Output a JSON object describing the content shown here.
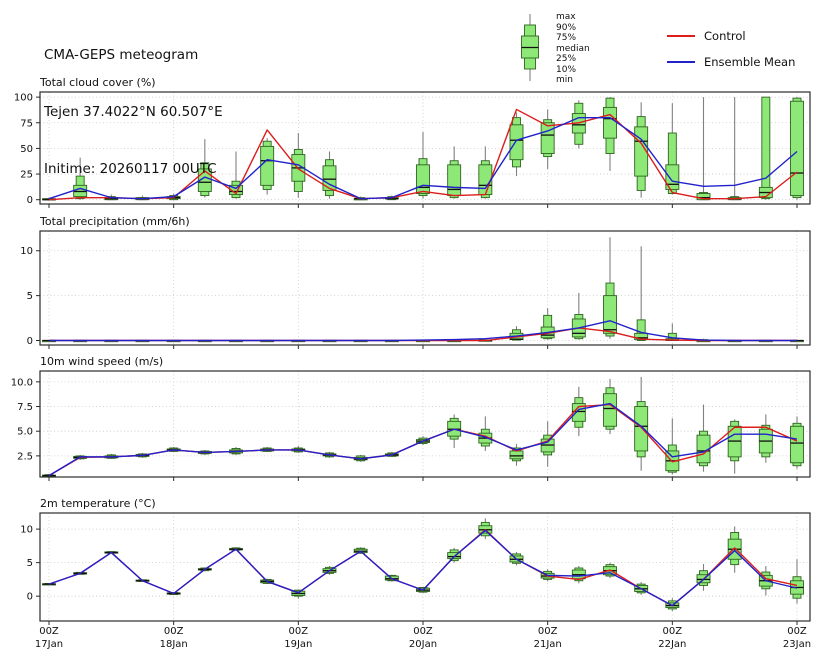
{
  "header": {
    "title": "CMA-GEPS meteogram",
    "location": "Tejen 37.4022°N 60.507°E",
    "inittime": "Initime: 20260117 00UTC"
  },
  "legend": {
    "box_labels": [
      "max",
      "90%",
      "75%",
      "median",
      "25%",
      "10%",
      "min"
    ],
    "series": [
      {
        "label": "Control",
        "color": "#dd1c1c"
      },
      {
        "label": "Ensemble Mean",
        "color": "#2222cc"
      }
    ]
  },
  "colors": {
    "box_fill": "#8ee878",
    "box_stroke": "#2f6420",
    "median": "#111111",
    "whisker": "#808080",
    "control": "#dd1c1c",
    "ensemble": "#2222cc",
    "grid": "#c9c9c9",
    "frame": "#2b2b2b"
  },
  "x_axis": {
    "days": [
      {
        "hour": "00Z",
        "day": "17Jan"
      },
      {
        "hour": "00Z",
        "day": "18Jan"
      },
      {
        "hour": "00Z",
        "day": "19Jan"
      },
      {
        "hour": "00Z",
        "day": "20Jan"
      },
      {
        "hour": "00Z",
        "day": "21Jan"
      },
      {
        "hour": "00Z",
        "day": "22Jan"
      },
      {
        "hour": "00Z",
        "day": "23Jan"
      }
    ]
  },
  "chart_data": {
    "type": "boxplot-meteogram",
    "n_points": 25,
    "step_hours": 6,
    "time_labels": [
      "17Jan 00Z",
      "17Jan 06Z",
      "17Jan 12Z",
      "17Jan 18Z",
      "18Jan 00Z",
      "18Jan 06Z",
      "18Jan 12Z",
      "18Jan 18Z",
      "19Jan 00Z",
      "19Jan 06Z",
      "19Jan 12Z",
      "19Jan 18Z",
      "20Jan 00Z",
      "20Jan 06Z",
      "20Jan 12Z",
      "20Jan 18Z",
      "21Jan 00Z",
      "21Jan 06Z",
      "21Jan 12Z",
      "21Jan 18Z",
      "22Jan 00Z",
      "22Jan 06Z",
      "22Jan 12Z",
      "22Jan 18Z",
      "23Jan 00Z"
    ],
    "panels": [
      {
        "title": "Total cloud cover (%)",
        "ylim": [
          -4.2,
          105
        ],
        "ytick_vals": [
          0,
          25,
          50,
          75,
          100
        ],
        "ytick_labels": [
          "0",
          "25",
          "50",
          "75",
          "100"
        ],
        "box": {
          "min": [
            0,
            0,
            0,
            0,
            0,
            2,
            1,
            5,
            2,
            1,
            0,
            0,
            1,
            1,
            1,
            23,
            30,
            50,
            28,
            2,
            5,
            0,
            0,
            0,
            0
          ],
          "p10": [
            0,
            1,
            0,
            0,
            0,
            4,
            2,
            10,
            8,
            4,
            0,
            0,
            4,
            2,
            2,
            32,
            42,
            54,
            45,
            9,
            6,
            0,
            0,
            1,
            2
          ],
          "q25": [
            0,
            3,
            0,
            0,
            1,
            8,
            5,
            14,
            18,
            9,
            0,
            1,
            6,
            4,
            5,
            39,
            45,
            65,
            60,
            23,
            10,
            0,
            0,
            2,
            4
          ],
          "median": [
            0,
            8,
            1,
            1,
            2,
            17,
            8,
            38,
            31,
            20,
            1,
            1,
            12,
            10,
            14,
            58,
            63,
            73,
            79,
            57,
            15,
            2,
            1,
            7,
            26
          ],
          "q75": [
            1,
            14,
            2,
            2,
            3,
            30,
            14,
            52,
            44,
            33,
            1,
            2,
            34,
            34,
            34,
            73,
            75,
            84,
            90,
            71,
            34,
            6,
            2,
            12,
            96
          ],
          "p90": [
            1,
            23,
            3,
            2,
            4,
            36,
            18,
            57,
            49,
            39,
            2,
            3,
            40,
            38,
            38,
            80,
            78,
            94,
            99,
            81,
            65,
            7,
            3,
            100,
            99
          ],
          "max": [
            2,
            41,
            5,
            4,
            6,
            59,
            47,
            60,
            65,
            47,
            3,
            4,
            66,
            52,
            52,
            85,
            88,
            97,
            100,
            95,
            94,
            100,
            100,
            100,
            100
          ]
        },
        "control": [
          0,
          2,
          2,
          1,
          2,
          28,
          6,
          68,
          30,
          11,
          1,
          2,
          8,
          4,
          5,
          88,
          72,
          75,
          83,
          55,
          7,
          1,
          1,
          3,
          27
        ],
        "ensemble": [
          1,
          11,
          2,
          1,
          3,
          22,
          11,
          39,
          34,
          15,
          1,
          2,
          14,
          12,
          11,
          58,
          67,
          80,
          80,
          59,
          18,
          13,
          14,
          21,
          47
        ]
      },
      {
        "title": "Total precipitation (mm/6h)",
        "ylim": [
          -0.5,
          12.2
        ],
        "ytick_vals": [
          0,
          5,
          10
        ],
        "ytick_labels": [
          "0",
          "5",
          "10"
        ],
        "box": {
          "min": [
            0,
            0,
            0,
            0,
            0,
            0,
            0,
            0,
            0,
            0,
            0,
            0,
            0,
            0,
            0,
            0,
            0.1,
            0.1,
            0.2,
            0,
            0,
            0,
            0,
            0,
            0
          ],
          "p10": [
            0,
            0,
            0,
            0,
            0,
            0,
            0,
            0,
            0,
            0,
            0,
            0,
            0,
            0,
            0,
            0.05,
            0.2,
            0.2,
            0.5,
            0,
            0,
            0,
            0,
            0,
            0
          ],
          "q25": [
            0,
            0,
            0,
            0,
            0,
            0,
            0,
            0,
            0,
            0,
            0,
            0,
            0,
            0,
            0,
            0.1,
            0.3,
            0.4,
            0.8,
            0.1,
            0,
            0,
            0,
            0,
            0
          ],
          "median": [
            0,
            0,
            0,
            0,
            0,
            0,
            0,
            0,
            0,
            0,
            0,
            0,
            0,
            0,
            0,
            0.15,
            0.6,
            0.8,
            1.2,
            0.3,
            0.05,
            0,
            0,
            0,
            0
          ],
          "q75": [
            0,
            0,
            0,
            0,
            0,
            0,
            0,
            0,
            0,
            0,
            0,
            0,
            0,
            0,
            0.05,
            0.8,
            1.5,
            2.4,
            5.0,
            0.8,
            0.2,
            0,
            0,
            0,
            0
          ],
          "p90": [
            0,
            0,
            0,
            0,
            0,
            0,
            0,
            0,
            0,
            0,
            0,
            0,
            0,
            0,
            0.05,
            1.2,
            2.8,
            2.9,
            6.4,
            2.3,
            0.8,
            0.1,
            0,
            0,
            0
          ],
          "max": [
            0,
            0,
            0,
            0,
            0,
            0,
            0,
            0,
            0,
            0,
            0,
            0,
            0,
            0.05,
            0.1,
            1.6,
            3.6,
            5.3,
            11.5,
            10.5,
            1.9,
            0.2,
            0,
            0,
            0
          ]
        },
        "control": [
          0,
          0,
          0,
          0,
          0,
          0,
          0,
          0,
          0,
          0,
          0,
          0,
          0,
          0,
          0,
          0.4,
          0.8,
          1.4,
          1.0,
          0.15,
          0.05,
          0,
          0,
          0,
          0
        ],
        "ensemble": [
          0,
          0,
          0,
          0,
          0,
          0,
          0,
          0,
          0,
          0,
          0,
          0,
          0.05,
          0.1,
          0.2,
          0.5,
          0.9,
          1.4,
          2.2,
          0.9,
          0.3,
          0.05,
          0,
          0,
          0
        ]
      },
      {
        "title": "10m wind speed (m/s)",
        "ylim": [
          0.36,
          11.1
        ],
        "ytick_vals": [
          2.5,
          5.0,
          7.5,
          10.0
        ],
        "ytick_labels": [
          "2.5",
          "5.0",
          "7.5",
          "10.0"
        ],
        "box": {
          "min": [
            0.35,
            2.1,
            2.2,
            2.3,
            2.9,
            2.6,
            2.6,
            2.9,
            2.8,
            2.3,
            1.9,
            2.4,
            3.6,
            3.3,
            3.0,
            1.5,
            1.4,
            4.5,
            4.7,
            1.0,
            0.6,
            0.9,
            0.7,
            1.8,
            1.2
          ],
          "p10": [
            0.4,
            2.2,
            2.25,
            2.4,
            2.95,
            2.7,
            2.7,
            2.95,
            2.9,
            2.4,
            2.0,
            2.45,
            3.75,
            4.2,
            3.5,
            2.0,
            2.6,
            5.4,
            5.2,
            2.4,
            0.85,
            1.5,
            2.0,
            2.4,
            1.5
          ],
          "q25": [
            0.45,
            2.25,
            2.3,
            2.45,
            3.0,
            2.75,
            2.8,
            3.0,
            3.0,
            2.5,
            2.1,
            2.5,
            3.85,
            4.5,
            3.8,
            2.2,
            2.9,
            6.0,
            5.5,
            3.0,
            1.0,
            1.8,
            2.4,
            2.8,
            1.8
          ],
          "median": [
            0.5,
            2.35,
            2.4,
            2.55,
            3.1,
            2.85,
            2.95,
            3.1,
            3.1,
            2.6,
            2.2,
            2.6,
            4.0,
            5.2,
            4.3,
            2.5,
            3.6,
            7.0,
            7.3,
            5.5,
            2.0,
            3.0,
            4.0,
            4.0,
            3.8
          ],
          "q75": [
            0.55,
            2.45,
            2.5,
            2.65,
            3.2,
            2.95,
            3.1,
            3.2,
            3.2,
            2.7,
            2.35,
            2.7,
            4.15,
            6.0,
            4.8,
            3.0,
            4.2,
            7.8,
            8.8,
            7.5,
            3.0,
            4.6,
            5.5,
            5.2,
            5.5
          ],
          "p90": [
            0.6,
            2.5,
            2.6,
            2.7,
            3.3,
            3.0,
            3.25,
            3.3,
            3.3,
            2.8,
            2.5,
            2.8,
            4.3,
            6.3,
            5.2,
            3.3,
            4.6,
            8.4,
            9.4,
            8.0,
            3.6,
            5.0,
            6.0,
            5.6,
            5.8
          ],
          "max": [
            0.65,
            2.6,
            2.7,
            2.8,
            3.4,
            3.1,
            3.4,
            3.4,
            3.5,
            2.9,
            2.6,
            2.9,
            4.5,
            6.7,
            6.5,
            3.7,
            6.0,
            9.5,
            10.3,
            10.5,
            6.3,
            7.7,
            6.2,
            6.7,
            6.5
          ]
        },
        "control": [
          0.5,
          2.35,
          2.4,
          2.55,
          3.1,
          2.85,
          2.95,
          3.1,
          3.1,
          2.6,
          2.2,
          2.6,
          4.0,
          5.2,
          4.5,
          3.0,
          4.0,
          7.5,
          7.7,
          5.4,
          1.9,
          2.7,
          5.4,
          5.4,
          4.0
        ],
        "ensemble": [
          0.5,
          2.4,
          2.4,
          2.55,
          3.1,
          2.85,
          2.95,
          3.1,
          3.1,
          2.6,
          2.2,
          2.6,
          4.0,
          5.2,
          4.4,
          3.1,
          3.9,
          7.2,
          7.8,
          5.5,
          2.4,
          2.9,
          4.7,
          4.7,
          4.2
        ]
      },
      {
        "title": "2m temperature (°C)",
        "ylim": [
          -3.7,
          12.4
        ],
        "ytick_vals": [
          0,
          5,
          10
        ],
        "ytick_labels": [
          "0",
          "5",
          "10"
        ],
        "box": {
          "min": [
            1.65,
            3.2,
            6.35,
            2.15,
            0.2,
            3.7,
            6.8,
            1.8,
            -0.4,
            3.2,
            6.3,
            2.2,
            0.5,
            5.0,
            8.5,
            4.6,
            2.2,
            1.9,
            2.7,
            0.2,
            -2.2,
            0.8,
            3.5,
            0.1,
            -1.1
          ],
          "p10": [
            1.7,
            3.25,
            6.4,
            2.2,
            0.25,
            3.8,
            6.85,
            1.9,
            0.0,
            3.4,
            6.4,
            2.3,
            0.6,
            5.3,
            9.0,
            4.9,
            2.5,
            2.3,
            3.0,
            0.5,
            -1.9,
            1.6,
            4.7,
            1.1,
            -0.3
          ],
          "q25": [
            1.75,
            3.3,
            6.45,
            2.25,
            0.3,
            3.9,
            6.9,
            2.0,
            0.1,
            3.55,
            6.5,
            2.4,
            0.7,
            5.6,
            9.4,
            5.1,
            2.7,
            2.6,
            3.2,
            0.7,
            -1.7,
            2.0,
            5.5,
            1.5,
            0.3
          ],
          "median": [
            1.8,
            3.4,
            6.5,
            2.3,
            0.4,
            4.0,
            7.0,
            2.2,
            0.4,
            3.8,
            6.7,
            2.6,
            0.9,
            5.9,
            9.9,
            5.5,
            3.0,
            3.2,
            3.8,
            1.1,
            -1.4,
            2.5,
            7.0,
            2.3,
            1.3
          ],
          "q75": [
            1.85,
            3.5,
            6.6,
            2.4,
            0.5,
            4.1,
            7.1,
            2.4,
            0.75,
            4.1,
            7.0,
            3.0,
            1.2,
            6.5,
            10.5,
            6.0,
            3.4,
            3.9,
            4.4,
            1.6,
            -1.0,
            3.2,
            8.5,
            3.1,
            2.3
          ],
          "p90": [
            1.9,
            3.55,
            6.65,
            2.45,
            0.55,
            4.2,
            7.2,
            2.5,
            0.9,
            4.3,
            7.15,
            3.1,
            1.3,
            6.9,
            11.0,
            6.3,
            3.7,
            4.2,
            4.7,
            1.8,
            -0.7,
            3.8,
            9.5,
            3.6,
            2.9
          ],
          "max": [
            1.95,
            3.6,
            6.7,
            2.5,
            0.6,
            4.3,
            7.3,
            2.6,
            1.0,
            4.5,
            7.3,
            3.2,
            1.4,
            7.2,
            11.6,
            6.6,
            4.0,
            4.5,
            5.0,
            2.1,
            -0.3,
            4.8,
            10.4,
            4.5,
            5.5
          ]
        },
        "control": [
          1.8,
          3.4,
          6.5,
          2.3,
          0.4,
          4.0,
          7.0,
          2.2,
          0.5,
          3.8,
          6.7,
          2.6,
          0.9,
          5.9,
          9.9,
          5.5,
          3.0,
          2.5,
          3.9,
          1.1,
          -1.4,
          2.5,
          7.2,
          2.6,
          1.6
        ],
        "ensemble": [
          1.8,
          3.4,
          6.5,
          2.3,
          0.4,
          4.0,
          7.0,
          2.2,
          0.5,
          3.8,
          6.7,
          2.6,
          0.9,
          5.9,
          9.8,
          5.5,
          3.1,
          3.0,
          3.5,
          1.1,
          -1.4,
          2.5,
          6.8,
          2.3,
          1.2
        ]
      }
    ]
  }
}
